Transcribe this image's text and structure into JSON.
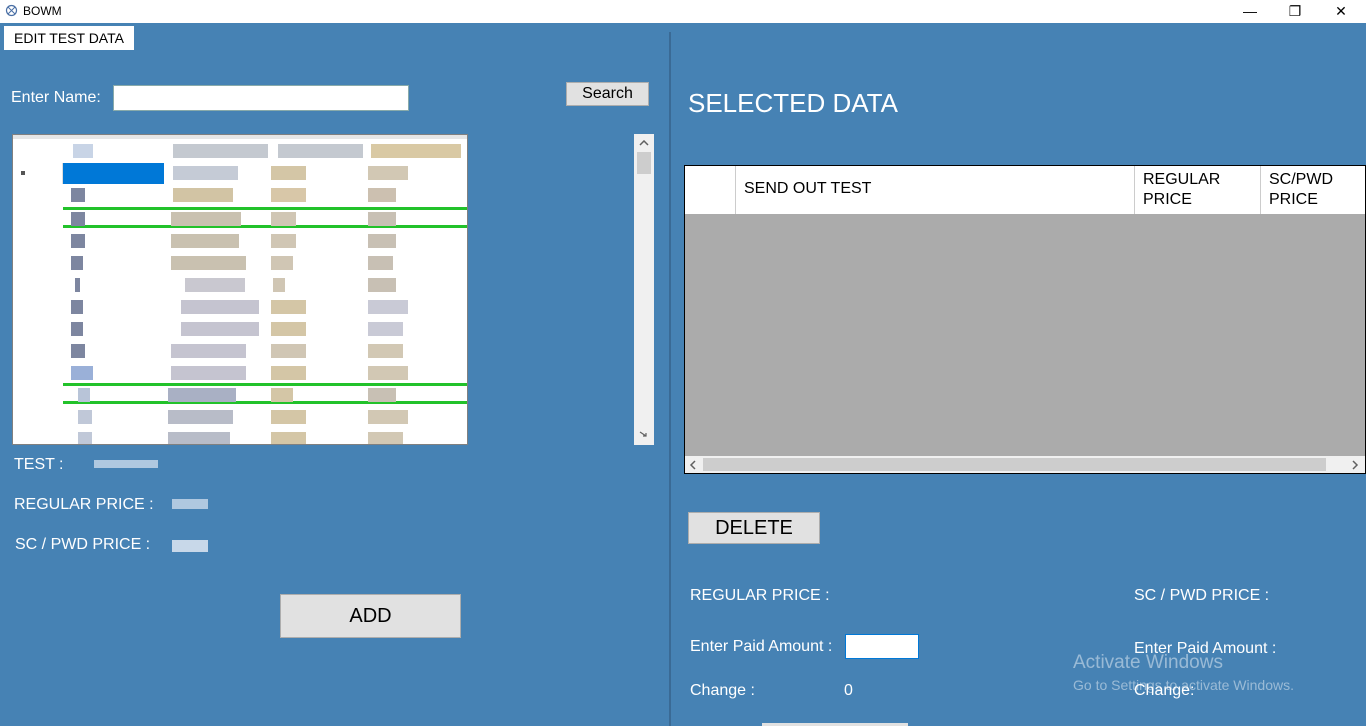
{
  "window": {
    "title": "BOWM",
    "minimize_glyph": "—",
    "maximize_glyph": "❐",
    "close_glyph": "✕"
  },
  "left": {
    "tab_label": "EDIT TEST DATA",
    "enter_name_label": "Enter Name:",
    "search_value": "",
    "search_button": "Search",
    "test_label": "TEST :",
    "regular_price_label": "REGULAR PRICE :",
    "sc_pwd_price_label": "SC / PWD PRICE :",
    "add_button": "ADD"
  },
  "right": {
    "title": "SELECTED DATA",
    "columns": [
      "SEND OUT TEST",
      "REGULAR PRICE",
      "SC/PWD PRICE"
    ],
    "delete_button": "DELETE",
    "regular_price_label": "REGULAR PRICE :",
    "sc_pwd_price_label": "SC / PWD PRICE :",
    "enter_paid_label": "Enter Paid Amount :",
    "enter_paid_label_2": "Enter Paid Amount :",
    "paid_value": "",
    "change_label": "Change :",
    "change_label_2": "Change:",
    "change_value": "0"
  },
  "watermark": {
    "line1": "Activate Windows",
    "line2": "Go to Settings to activate Windows."
  },
  "colors": {
    "background": "#4682b4",
    "selected_row": "#0078d7",
    "row_border": "#22c22a",
    "grid_empty": "#ababab"
  },
  "icons": {
    "left_scroll": "chevron-left-icon",
    "right_scroll": "chevron-right-icon",
    "up_scroll": "chevron-up-icon",
    "down_scroll": "chevron-down-icon"
  }
}
